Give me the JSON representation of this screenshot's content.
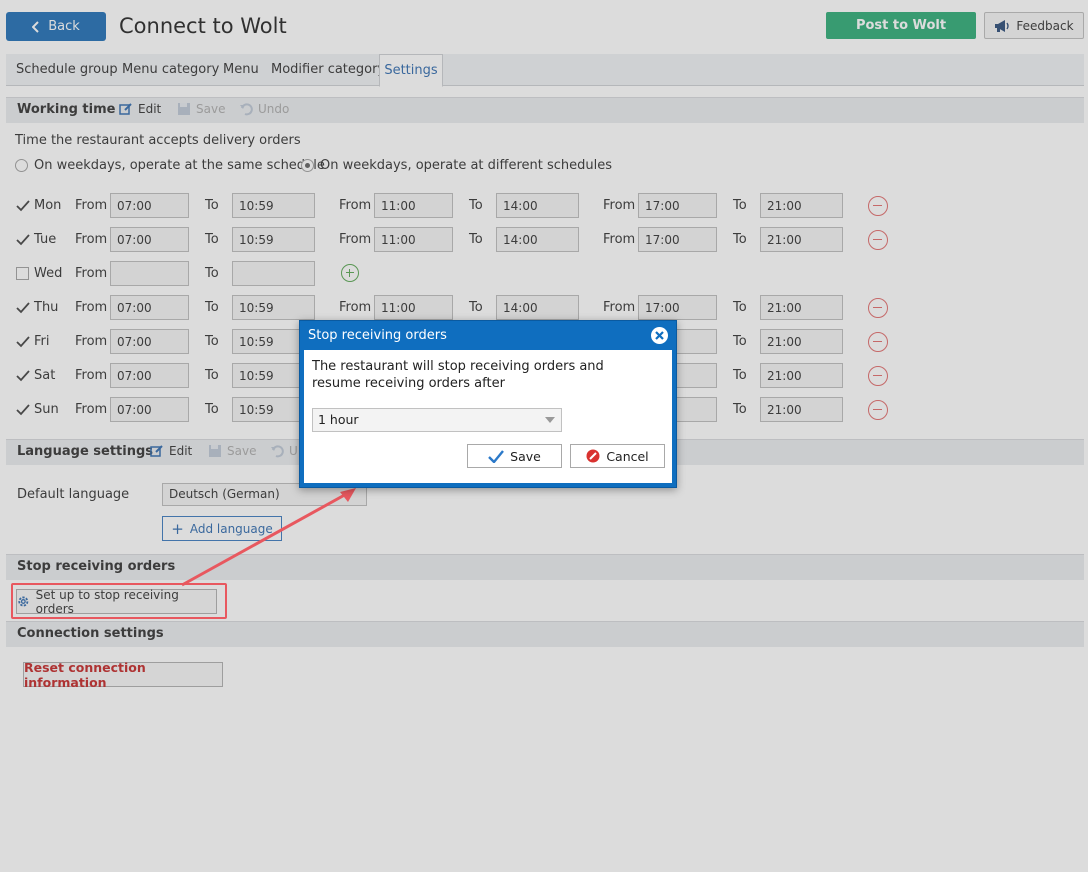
{
  "header": {
    "back_label": "Back",
    "title": "Connect to Wolt",
    "post_label": "Post to Wolt",
    "feedback_label": "Feedback"
  },
  "tabs": [
    "Schedule group",
    "Menu category",
    "Menu",
    "Modifier category",
    "Settings"
  ],
  "active_tab": "Settings",
  "working_time": {
    "title": "Working time",
    "edit": "Edit",
    "save": "Save",
    "undo": "Undo",
    "description": "Time the restaurant accepts delivery orders",
    "option_same": "On weekdays, operate at the same schedule",
    "option_different": "On weekdays, operate at different schedules",
    "selected_option": "different",
    "from_label": "From",
    "to_label": "To",
    "days": [
      {
        "day": "Mon",
        "checked": true,
        "slots": [
          [
            "07:00",
            "10:59"
          ],
          [
            "11:00",
            "14:00"
          ],
          [
            "17:00",
            "21:00"
          ]
        ]
      },
      {
        "day": "Tue",
        "checked": true,
        "slots": [
          [
            "07:00",
            "10:59"
          ],
          [
            "11:00",
            "14:00"
          ],
          [
            "17:00",
            "21:00"
          ]
        ]
      },
      {
        "day": "Wed",
        "checked": false,
        "slots": [
          [
            "",
            ""
          ]
        ]
      },
      {
        "day": "Thu",
        "checked": true,
        "slots": [
          [
            "07:00",
            "10:59"
          ],
          [
            "11:00",
            "14:00"
          ],
          [
            "17:00",
            "21:00"
          ]
        ]
      },
      {
        "day": "Fri",
        "checked": true,
        "slots": [
          [
            "07:00",
            "10:59"
          ],
          [
            "",
            ""
          ],
          [
            "",
            "21:00"
          ]
        ]
      },
      {
        "day": "Sat",
        "checked": true,
        "slots": [
          [
            "07:00",
            "10:59"
          ],
          [
            "",
            ""
          ],
          [
            "",
            "21:00"
          ]
        ]
      },
      {
        "day": "Sun",
        "checked": true,
        "slots": [
          [
            "07:00",
            "10:59"
          ],
          [
            "",
            ""
          ],
          [
            "",
            "21:00"
          ]
        ]
      }
    ]
  },
  "language": {
    "title": "Language settings",
    "edit": "Edit",
    "save": "Save",
    "undo_partial": "U",
    "default_label": "Default language",
    "default_value": "Deutsch (German)",
    "add_label": "Add language"
  },
  "stop_orders": {
    "title": "Stop receiving orders",
    "button_label": "Set up to stop receiving orders"
  },
  "connection": {
    "title": "Connection settings",
    "reset_label": "Reset connection information"
  },
  "dialog": {
    "title": "Stop receiving orders",
    "message": "The restaurant will stop receiving orders and resume receiving orders after",
    "duration_value": "1 hour",
    "save_label": "Save",
    "cancel_label": "Cancel"
  },
  "colors": {
    "primary": "#0d63b0",
    "success": "#1da56b",
    "danger": "#e06060",
    "dialog": "#0f6ebf",
    "annotation": "#e8585f"
  }
}
